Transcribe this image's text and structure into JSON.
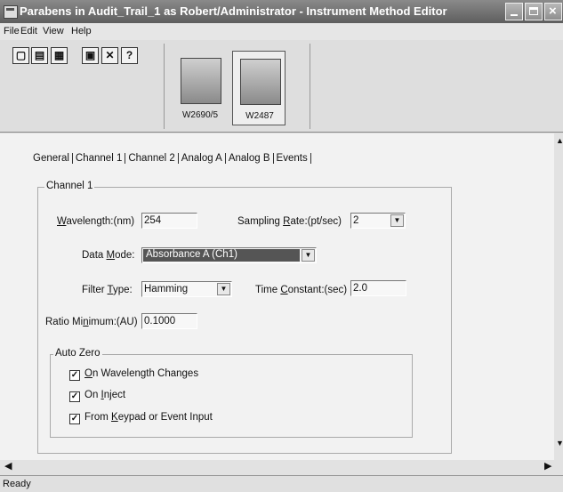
{
  "window": {
    "title": "Parabens in Audit_Trail_1 as Robert/Administrator - Instrument Method Editor"
  },
  "menu": {
    "items": [
      "File",
      "Edit",
      "View",
      "Help"
    ]
  },
  "toolbar": {
    "icons": [
      "new-icon",
      "open-icon",
      "save-icon",
      "print-icon",
      "delete-icon",
      "help-pointer-icon"
    ],
    "delete_glyph": "✕",
    "help_glyph": "?"
  },
  "instruments": [
    {
      "label": "W2690/5"
    },
    {
      "label": "W2487"
    }
  ],
  "tabs": [
    "General",
    "Channel 1",
    "Channel 2",
    "Analog A",
    "Analog B",
    "Events"
  ],
  "channel": {
    "group_title": "Channel 1",
    "wavelength": {
      "label_pre": "",
      "label_ul": "W",
      "label_post": "avelength:(nm)",
      "value": "254"
    },
    "sampling_rate": {
      "label_pre": "Sampling ",
      "label_ul": "R",
      "label_post": "ate:(pt/sec)",
      "value": "2"
    },
    "data_mode": {
      "label_pre": "Data ",
      "label_ul": "M",
      "label_post": "ode:",
      "value": "Absorbance A (Ch1)"
    },
    "filter_type": {
      "label_pre": "Filter ",
      "label_ul": "T",
      "label_post": "ype:",
      "value": "Hamming"
    },
    "time_constant": {
      "label_pre": "Time ",
      "label_ul": "C",
      "label_post": "onstant:(sec)",
      "value": "2.0"
    },
    "ratio_minimum": {
      "label_pre": "Ratio Mi",
      "label_ul": "n",
      "label_post": "imum:(AU)",
      "value": "0.1000"
    }
  },
  "auto_zero": {
    "title": "Auto Zero",
    "options": [
      {
        "label_pre": "",
        "label_ul": "O",
        "label_post": "n Wavelength Changes",
        "checked": true
      },
      {
        "label_pre": "On ",
        "label_ul": "I",
        "label_post": "nject",
        "checked": true
      },
      {
        "label_pre": "From ",
        "label_ul": "K",
        "label_post": "eypad or Event Input",
        "checked": true
      }
    ]
  },
  "status": {
    "text": "Ready"
  }
}
